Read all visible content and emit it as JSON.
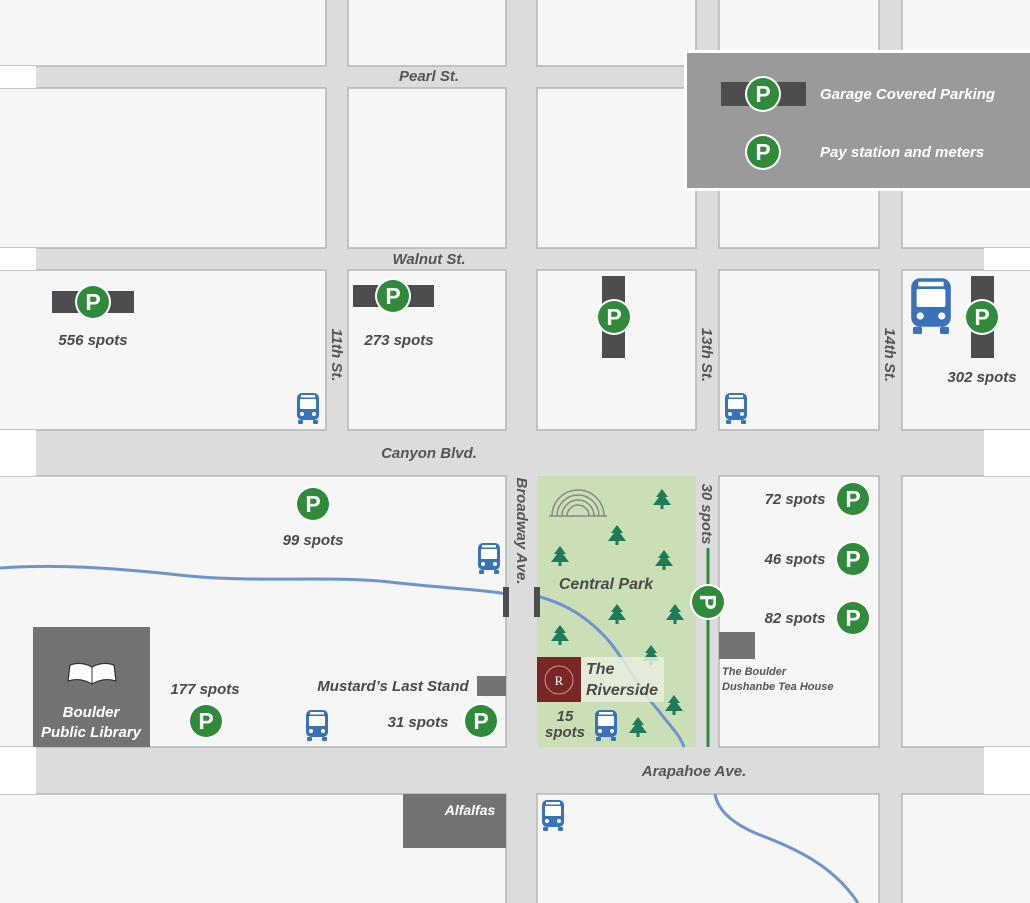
{
  "streets": {
    "pearl": "Pearl St.",
    "walnut": "Walnut St.",
    "canyon": "Canyon Blvd.",
    "arapahoe": "Arapahoe Ave.",
    "eleventh": "11th St.",
    "broadway": "Broadway Ave.",
    "thirteenth": "13th St.",
    "fourteenth": "14th St.",
    "thirty_spots": "30 spots"
  },
  "legend": {
    "garage": "Garage Covered Parking",
    "pay": "Pay station and meters"
  },
  "parking_symbol": "P",
  "spots": {
    "s556": "556 spots",
    "s273": "273 spots",
    "s302": "302 spots",
    "s99": "99 spots",
    "s177": "177 spots",
    "s31": "31 spots",
    "s15a": "15",
    "s15b": "spots",
    "s72": "72 spots",
    "s46": "46 spots",
    "s82": "82 spots"
  },
  "places": {
    "central_park": "Central Park",
    "riverside_1": "The",
    "riverside_2": "Riverside",
    "riverside_logo": "R",
    "mustards": "Mustard’s Last Stand",
    "alfalfas": "Alfalfas",
    "library_1": "Boulder",
    "library_2": "Public Library",
    "teahouse_1": "The Boulder",
    "teahouse_2": "Dushanbe Tea House"
  },
  "colors": {
    "road": "#dcdcdc",
    "block": "#f5f6f5",
    "block_stroke": "#b5b5b5",
    "park": "#cbdfb7",
    "parking_green": "#2f8a3a",
    "garage_gray": "#4d4d4f",
    "bus_blue": "#3a72b9",
    "creek_blue": "#6e93cf",
    "building_gray": "#737373",
    "riverside_red": "#7a2527",
    "tree": "#1f7a5a"
  }
}
